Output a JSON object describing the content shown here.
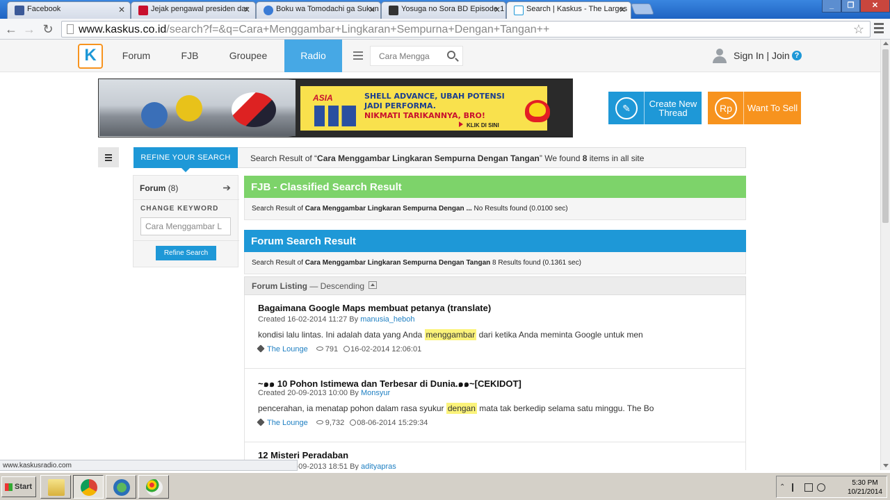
{
  "browser": {
    "tabs": [
      {
        "label": "Facebook",
        "color": "#3b5998"
      },
      {
        "label": "Jejak pengawal presiden dar",
        "color": "#c8102e"
      },
      {
        "label": "Boku wa Tomodachi ga Sukun",
        "color": "#3a7bd5"
      },
      {
        "label": "Yosuga no Sora BD Episode 1",
        "color": "#333333"
      },
      {
        "label": "Search | Kaskus - The Larges",
        "color": "#1e98d7"
      }
    ],
    "url_host": "www.kaskus.co.id",
    "url_path": "/search?f=&q=Cara+Menggambar+Lingkaran+Sempurna+Dengan+Tangan++",
    "status_url": "www.kaskusradio.com"
  },
  "header": {
    "logo": "K",
    "nav": [
      "Forum",
      "FJB",
      "Groupee",
      "Radio"
    ],
    "active_nav": "Radio",
    "search_value": "Cara Mengga",
    "signin": "Sign In | Join",
    "help": "?"
  },
  "banner": {
    "brand": "ASIA",
    "line1": "SHELL ADVANCE, UBAH POTENSI",
    "line2": "JADI PERFORMA.",
    "line3": "NIKMATI TARIKANNYA, BRO!",
    "cta": "KLIK DI SINI"
  },
  "actions": {
    "create_thread": "Create New Thread",
    "want_to_sell": "Want To Sell",
    "rp": "Rp"
  },
  "refine": {
    "tab_label": "REFINE YOUR SEARCH",
    "forum_label": "Forum",
    "forum_count": "(8)",
    "change_keyword": "CHANGE KEYWORD",
    "keyword_value": "Cara Menggambar L",
    "button": "Refine Search"
  },
  "summary": {
    "prefix": "Search Result of “",
    "query": "Cara Menggambar Lingkaran Sempurna Dengan Tangan",
    "mid": "” We found ",
    "count": "8",
    "suffix": " items in all site"
  },
  "fjb": {
    "title": "FJB - Classified Search Result",
    "color": "#7dd36a",
    "sub_prefix": "Search Result of ",
    "sub_query": "Cara Menggambar Lingkaran Sempurna Dengan ...",
    "sub_suffix": "  No Results found (0.0100 sec)"
  },
  "forum": {
    "title": "Forum Search Result",
    "color": "#1e98d7",
    "sub_prefix": "Search Result of ",
    "sub_query": "Cara Menggambar Lingkaran Sempurna Dengan Tangan",
    "sub_suffix": " 8 Results found (0.1361 sec)",
    "listing_label": "Forum Listing",
    "listing_order": " — Descending"
  },
  "threads": [
    {
      "title": "Bagaimana Google Maps membuat petanya (translate)",
      "created": "Created 16-02-2014 11:27 By ",
      "author": "manusia_heboh",
      "snippet_before": "kondisi lalu lintas. Ini adalah data yang Anda ",
      "highlight": "menggambar",
      "snippet_after": " dari ketika Anda meminta Google untuk men",
      "category": "The Lounge",
      "views": "791",
      "last_post": "16-02-2014 12:06:01"
    },
    {
      "title": "~๑๑ 10 Pohon Istimewa dan Terbesar di Dunia.๑๑~[CEKIDOT]",
      "created": "Created 20-09-2013 10:00 By ",
      "author": "Monsyur",
      "snippet_before": "pencerahan, ia menatap pohon dalam rasa syukur ",
      "highlight": "dengan",
      "snippet_after": " mata tak berkedip selama satu minggu. The Bo",
      "category": "The Lounge",
      "views": "9,732",
      "last_post": "08-06-2014 15:29:34"
    },
    {
      "title": "12 Misteri Peradaban",
      "created": "Created 15-09-2013 18:51 By ",
      "author": "adityapras",
      "snippet_before": "",
      "highlight": "",
      "snippet_after": "",
      "category": "",
      "views": "",
      "last_post": ""
    }
  ],
  "taskbar": {
    "start": "Start",
    "time": "5:30 PM",
    "date": "10/21/2014"
  }
}
